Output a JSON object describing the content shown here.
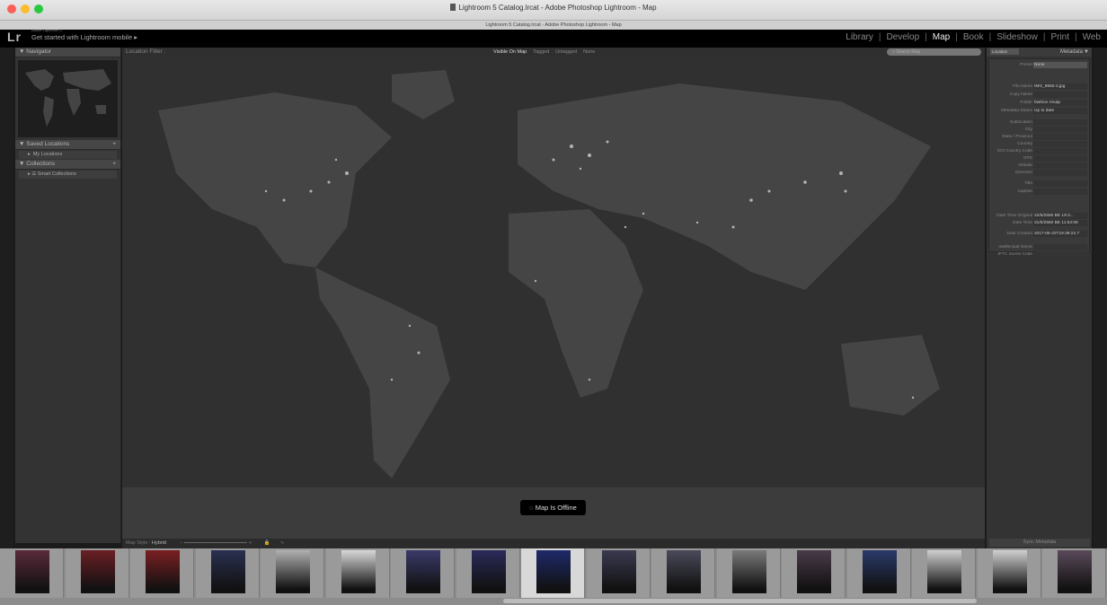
{
  "window": {
    "title": "Lightroom 5 Catalog.lrcat - Adobe Photoshop Lightroom - Map",
    "tab": "Lightroom 5 Catalog.lrcat - Adobe Photoshop Lightroom - Map"
  },
  "identity": {
    "logo": "Lr",
    "app_name": "Adobe Lightroom 5",
    "mobile_prompt": "Get started with Lightroom mobile ▸"
  },
  "modules": [
    "Library",
    "Develop",
    "Map",
    "Book",
    "Slideshow",
    "Print",
    "Web"
  ],
  "active_module": "Map",
  "left_panel": {
    "navigator": "Navigator",
    "saved_locations": "Saved Locations",
    "my_locations": "My Locations",
    "collections": "Collections",
    "smart_collections": "Smart Collections"
  },
  "location_filter": {
    "label": "Location Filter :",
    "options": [
      "Visible On Map",
      "Tagged",
      "Untagged",
      "None"
    ],
    "active": "Visible On Map",
    "search_placeholder": "Search Map"
  },
  "map": {
    "status": "Map Is Offline"
  },
  "map_toolbar": {
    "style_label": "Map Style :",
    "style_value": "Hybrid"
  },
  "right_panel": {
    "location_dropdown": "Location",
    "metadata_title": "Metadata",
    "preset_label": "Preset",
    "preset_value": "None",
    "fields": [
      {
        "k": "File Name",
        "v": "IMG_8982-2.jpg"
      },
      {
        "k": "Copy Name",
        "v": ""
      },
      {
        "k": "Folder",
        "v": "fashion rmutp"
      },
      {
        "k": "Metadata Status",
        "v": "Up to date"
      },
      {
        "k": "Sublocation",
        "v": ""
      },
      {
        "k": "City",
        "v": ""
      },
      {
        "k": "State / Province",
        "v": ""
      },
      {
        "k": "Country",
        "v": ""
      },
      {
        "k": "ISO Country Code",
        "v": ""
      },
      {
        "k": "GPS",
        "v": ""
      },
      {
        "k": "Altitude",
        "v": ""
      },
      {
        "k": "Direction",
        "v": ""
      },
      {
        "k": "Title",
        "v": ""
      },
      {
        "k": "Caption",
        "v": ""
      },
      {
        "k": "Date Time Original",
        "v": "22/5/2560 BE 19:3..."
      },
      {
        "k": "Date Time",
        "v": "31/5/2560 BE 11:54:08"
      },
      {
        "k": "Date Created",
        "v": "2017-05-22T19:39:22.7"
      },
      {
        "k": "Intellectual Genre",
        "v": ""
      },
      {
        "k": "IPTC Scene Code",
        "v": ""
      }
    ],
    "sync_button": "Sync Metadata"
  },
  "filmstrip": {
    "count": 17,
    "selected_index": 8
  }
}
